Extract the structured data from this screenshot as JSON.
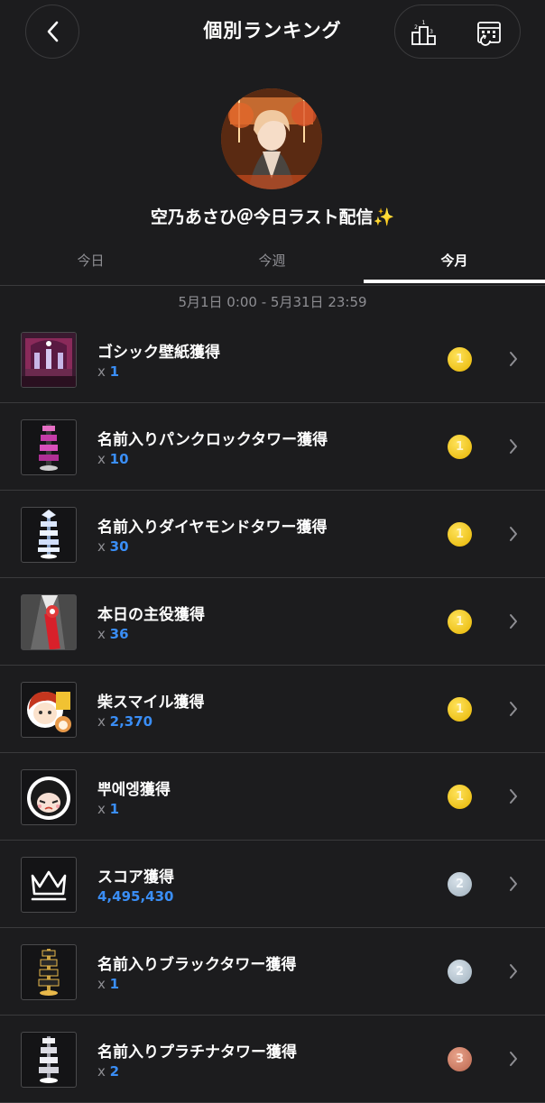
{
  "header": {
    "title": "個別ランキング"
  },
  "profile": {
    "name": "空乃あさひ＠今日ラスト配信✨"
  },
  "tabs": [
    {
      "label": "今日",
      "active": false
    },
    {
      "label": "今週",
      "active": false
    },
    {
      "label": "今月",
      "active": true
    }
  ],
  "date_range": "5月1日 0:00 - 5月31日 23:59",
  "items": [
    {
      "title": "ゴシック壁紙獲得",
      "prefix": "x",
      "count": "1",
      "rank": "1",
      "icon": "gothic-wallpaper-icon"
    },
    {
      "title": "名前入りパンクロックタワー獲得",
      "prefix": "x",
      "count": "10",
      "rank": "1",
      "icon": "punk-rock-tower-icon"
    },
    {
      "title": "名前入りダイヤモンドタワー獲得",
      "prefix": "x",
      "count": "30",
      "rank": "1",
      "icon": "diamond-tower-icon"
    },
    {
      "title": "本日の主役獲得",
      "prefix": "x",
      "count": "36",
      "rank": "1",
      "icon": "todays-star-sash-icon"
    },
    {
      "title": "柴スマイル獲得",
      "prefix": "x",
      "count": "2,370",
      "rank": "1",
      "icon": "shiba-smile-sticker-icon"
    },
    {
      "title": "뿌에엥獲得",
      "prefix": "x",
      "count": "1",
      "rank": "1",
      "icon": "crying-character-sticker-icon"
    },
    {
      "title": "スコア獲得",
      "prefix": "",
      "count": "4,495,430",
      "rank": "2",
      "icon": "crown-icon"
    },
    {
      "title": "名前入りブラックタワー獲得",
      "prefix": "x",
      "count": "1",
      "rank": "2",
      "icon": "black-tower-icon"
    },
    {
      "title": "名前入りプラチナタワー獲得",
      "prefix": "x",
      "count": "2",
      "rank": "3",
      "icon": "platinum-tower-icon"
    }
  ],
  "colors": {
    "background": "#1c1c1e",
    "accent_blue": "#3a8ef6",
    "medal_gold": "#f5c400",
    "medal_silver": "#b9c6d0",
    "medal_bronze": "#d07a60"
  }
}
